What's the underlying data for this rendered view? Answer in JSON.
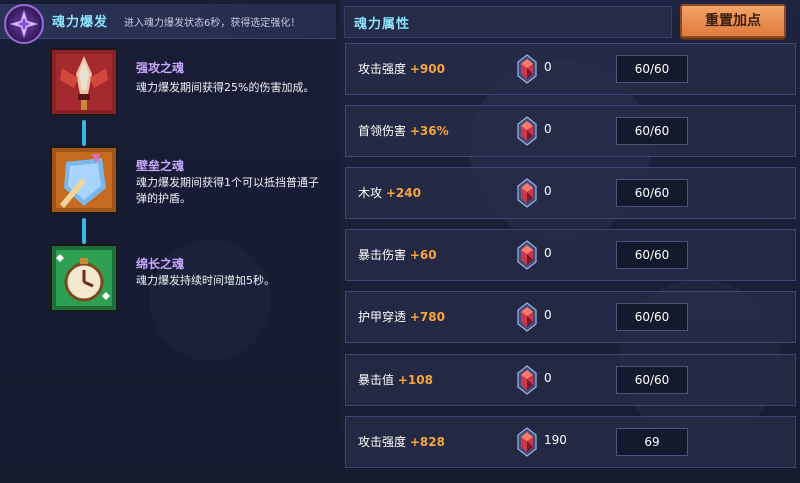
{
  "header": {
    "title": "魂力爆发",
    "description": "进入魂力爆发状态6秒，获得选定强化！"
  },
  "skills": [
    {
      "name": "强攻之魂",
      "description": "魂力爆发期间获得25%的伤害加成。",
      "icon": "red-dagger-icon"
    },
    {
      "name": "壁垒之魂",
      "description": "魂力爆发期间获得1个可以抵挡普通子弹的护盾。",
      "icon": "shield-icon"
    },
    {
      "name": "绵长之魂",
      "description": "魂力爆发持续时间增加5秒。",
      "icon": "clock-icon"
    }
  ],
  "attributes": {
    "title": "魂力属性",
    "reset_label": "重置加点",
    "rows": [
      {
        "label": "攻击强度",
        "bonus": "+900",
        "gems": "0",
        "level": "60/60"
      },
      {
        "label": "首领伤害",
        "bonus": "+36%",
        "gems": "0",
        "level": "60/60"
      },
      {
        "label": "木攻",
        "bonus": "+240",
        "gems": "0",
        "level": "60/60"
      },
      {
        "label": "暴击伤害",
        "bonus": "+60",
        "gems": "0",
        "level": "60/60"
      },
      {
        "label": "护甲穿透",
        "bonus": "+780",
        "gems": "0",
        "level": "60/60"
      },
      {
        "label": "暴击值",
        "bonus": "+108",
        "gems": "0",
        "level": "60/60"
      },
      {
        "label": "攻击强度",
        "bonus": "+828",
        "gems": "190",
        "level": "69"
      }
    ]
  },
  "colors": {
    "accent_cyan": "#8fe3ff",
    "bonus_orange": "#f7a43c",
    "skill_name_purple": "#c8a7ff",
    "reset_button": "#e68a4a"
  }
}
